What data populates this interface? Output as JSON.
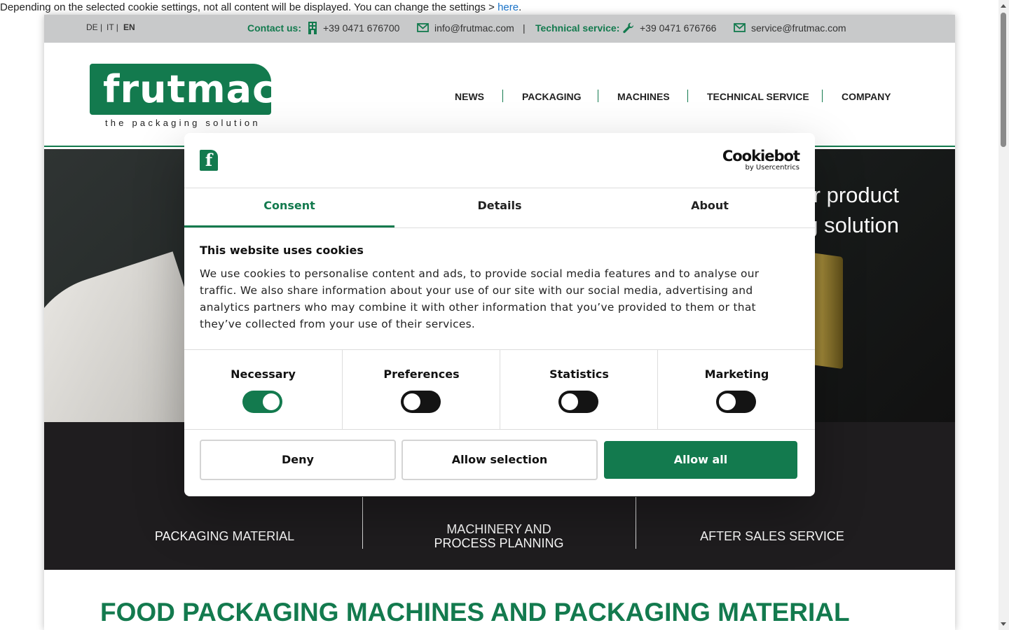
{
  "notice": {
    "text": "Depending on the selected cookie settings, not all content will be displayed. You can change the settings > ",
    "link": "here",
    "end": "."
  },
  "topbar": {
    "languages": [
      "DE |",
      "IT |",
      "EN"
    ],
    "contact_label": "Contact us:",
    "phone": "+39 0471 676700",
    "email": "info@frutmac.com",
    "divider": "|",
    "tech_label": "Technical service:",
    "tech_phone": "+39 0471 676766",
    "tech_email": "service@frutmac.com"
  },
  "logo": {
    "word": "frutmac",
    "tagline": "the packaging solution"
  },
  "nav": {
    "items": [
      "NEWS",
      "PACKAGING",
      "MACHINES",
      "TECHNICAL SERVICE",
      "COMPANY"
    ]
  },
  "hero": {
    "line1": "r product",
    "line2": "g solution"
  },
  "categories": {
    "packaging": "PACKAGING MATERIAL",
    "machinery_l1": "MACHINERY AND",
    "machinery_l2": "PROCESS PLANNING",
    "service": "AFTER SALES SERVICE"
  },
  "main": {
    "title": "FOOD PACKAGING MACHINES AND PACKAGING MATERIAL"
  },
  "dialog": {
    "logo_letter": "f",
    "cookiebot": "Cookiebot",
    "cookiebot_sub": "by Usercentrics",
    "tabs": [
      "Consent",
      "Details",
      "About"
    ],
    "title": "This website uses cookies",
    "body": "We use cookies to personalise content and ads, to provide social media features and to analyse our traffic. We also share information about your use of our site with our social media, advertising and analytics partners who may combine it with other information that you’ve provided to them or that they’ve collected from your use of their services.",
    "toggles": [
      {
        "label": "Necessary",
        "on": true
      },
      {
        "label": "Preferences",
        "on": false
      },
      {
        "label": "Statistics",
        "on": false
      },
      {
        "label": "Marketing",
        "on": false
      }
    ],
    "buttons": {
      "deny": "Deny",
      "allow_selection": "Allow selection",
      "allow_all": "Allow all"
    }
  },
  "colors": {
    "brand_green": "#137a4e",
    "topbar_gray": "#c8c9ca",
    "band_dark": "#1f1d1f"
  }
}
